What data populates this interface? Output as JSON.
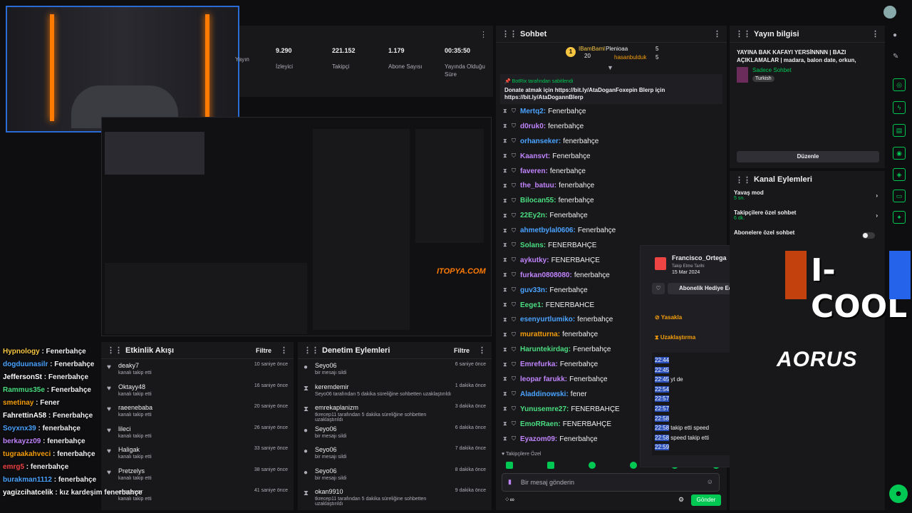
{
  "stats": [
    {
      "value": "",
      "label": "Yayın"
    },
    {
      "value": "9.290",
      "label": "İzleyici"
    },
    {
      "value": "221.152",
      "label": "Takipçi"
    },
    {
      "value": "1.179",
      "label": "Abone Sayısı"
    },
    {
      "value": "00:35:50",
      "label": "Yayında Olduğu Süre"
    }
  ],
  "activity": {
    "title": "Etkinlik Akışı",
    "filter": "Filtre",
    "items": [
      {
        "name": "deaky7",
        "sub": "kanalı takip etti",
        "time": "10 saniye önce"
      },
      {
        "name": "Oktayy48",
        "sub": "kanalı takip etti",
        "time": "16 saniye önce"
      },
      {
        "name": "raeenebaba",
        "sub": "kanalı takip etti",
        "time": "20 saniye önce"
      },
      {
        "name": "lileci",
        "sub": "kanalı takip etti",
        "time": "26 saniye önce"
      },
      {
        "name": "Haligak",
        "sub": "kanalı takip etti",
        "time": "33 saniye önce"
      },
      {
        "name": "Pretzelys",
        "sub": "kanalı takip etti",
        "time": "38 saniye önce"
      },
      {
        "name": "emsever",
        "sub": "kanalı takip etti",
        "time": "41 saniye önce"
      }
    ]
  },
  "moderation": {
    "title": "Denetim Eylemleri",
    "filter": "Filtre",
    "items": [
      {
        "name": "Seyo06",
        "sub": "bir mesajı sildi",
        "time": "6 saniye önce"
      },
      {
        "name": "keremdemir",
        "sub": "Seyo06 tarafından 5 dakika süreliğine sohbetten uzaklaştırıldı",
        "time": "1 dakika önce"
      },
      {
        "name": "emrekaplanizm",
        "sub": "tkrecep11 tarafından 5 dakika süreliğine sohbetten uzaklaştırıldı",
        "time": "3 dakika önce"
      },
      {
        "name": "Seyo06",
        "sub": "bir mesajı sildi",
        "time": "6 dakika önce"
      },
      {
        "name": "Seyo06",
        "sub": "bir mesajı sildi",
        "time": "7 dakika önce"
      },
      {
        "name": "Seyo06",
        "sub": "bir mesajı sildi",
        "time": "8 dakika önce"
      },
      {
        "name": "okan9910",
        "sub": "tkrecep11 tarafından 5 dakika süreliğine sohbetten uzaklaştırıldı",
        "time": "9 dakika önce"
      }
    ]
  },
  "overlay_chat": [
    {
      "user": "Hypnology",
      "text": " : Fenerbahçe",
      "color": "#f5c542"
    },
    {
      "user": "dogduunasilr",
      "text": " : Fenerbahçe",
      "color": "#4aa3ff"
    },
    {
      "user": "JeffersonSt",
      "text": " : Fenerbahçe",
      "color": "#ffffff"
    },
    {
      "user": "Rammus35e",
      "text": " : Fenerbahçe",
      "color": "#4ade80"
    },
    {
      "user": "smetinay",
      "text": " : Fener",
      "color": "#f59e0b"
    },
    {
      "user": "FahrettinA58",
      "text": " : Fenerbahçe",
      "color": "#ffffff"
    },
    {
      "user": "Soyxnx39",
      "text": " : fenerbahçe",
      "color": "#4aa3ff"
    },
    {
      "user": "berkayzz09",
      "text": " : fenerbahçe",
      "color": "#c084fc"
    },
    {
      "user": "tugraakahveci",
      "text": " : fenerbahçe",
      "color": "#f59e0b"
    },
    {
      "user": "emrg5",
      "text": " : fenerbahçe",
      "color": "#ef4444"
    },
    {
      "user": "burakman1112",
      "text": " : fenerbahçe",
      "color": "#4aa3ff"
    },
    {
      "user": "yagizcihatcelik",
      "text": " : kız kardeşim fenerbahçe",
      "color": "#ffffff"
    }
  ],
  "chat": {
    "title": "Sohbet",
    "top": [
      {
        "name": "IBamBaml",
        "count": "20"
      },
      {
        "name": "Plenioaa",
        "count": "5"
      },
      {
        "name": "hasanbulduk",
        "count": "5"
      }
    ],
    "pin_by": "BotRix tarafından sabitlendi",
    "pin_text": "Donate atmak için https://bit.ly/AtaDoganFoxepin Blerp için https://bit.ly/AtaDogannBlerp",
    "messages": [
      {
        "user": "Mertq2",
        "text": "Fenerbahçe",
        "color": "#4aa3ff"
      },
      {
        "user": "d0ruk0",
        "text": "fenerbahçe",
        "color": "#c084fc"
      },
      {
        "user": "orhanseker",
        "text": "fenerbahçe",
        "color": "#4aa3ff"
      },
      {
        "user": "Kaansvt",
        "text": "Fenerbahçe",
        "color": "#c084fc"
      },
      {
        "user": "faveren",
        "text": "fenerbahçe",
        "color": "#c084fc"
      },
      {
        "user": "the_batuu",
        "text": "fenerbahçe",
        "color": "#c084fc"
      },
      {
        "user": "Bilocan55",
        "text": "fenerbahçe",
        "color": "#4ade80"
      },
      {
        "user": "22Ey2n",
        "text": "Fenerbahçe",
        "color": "#4ade80"
      },
      {
        "user": "ahmetbylal0606",
        "text": "Fenerbahçe",
        "color": "#4aa3ff"
      },
      {
        "user": "Solans",
        "text": "FENERBAHÇE",
        "color": "#4ade80"
      },
      {
        "user": "aykutky",
        "text": "FENERBAHÇE",
        "color": "#c084fc"
      },
      {
        "user": "furkan0808080",
        "text": "fenerbahçe",
        "color": "#c084fc"
      },
      {
        "user": "guv33n",
        "text": "Fenerbahçe",
        "color": "#4aa3ff"
      },
      {
        "user": "Eege1",
        "text": "FENERBAHCE",
        "color": "#4ade80"
      },
      {
        "user": "esenyurtlumiko",
        "text": "fenerbahçe",
        "color": "#4aa3ff"
      },
      {
        "user": "muratturna",
        "text": "fenerbahçe",
        "color": "#f59e0b"
      },
      {
        "user": "Haruntekirdag",
        "text": "Fenerbahçe",
        "color": "#4ade80"
      },
      {
        "user": "Emrefurka",
        "text": "Fenerbahçe",
        "color": "#c084fc"
      },
      {
        "user": "leopar farukk",
        "text": "Fenerbahçe",
        "color": "#c084fc"
      },
      {
        "user": "Aladdinowski",
        "text": "fener",
        "color": "#4aa3ff"
      },
      {
        "user": "Yunusemre27",
        "text": "FENERBAHÇE",
        "color": "#4ade80"
      },
      {
        "user": "EmoRRaen",
        "text": "FENERBAHÇE",
        "color": "#4ade80"
      },
      {
        "user": "Eyazom09",
        "text": "Fenerbahçe",
        "color": "#c084fc"
      }
    ],
    "followers_only": "Takipçilere Özel",
    "placeholder": "Bir mesaj gönderin",
    "send": "Gönder"
  },
  "popup": {
    "name": "Francisco_Ortega",
    "follow_label": "Takip Etme Tarihi",
    "follow_date": "15 Mar 2024",
    "gift": "Abonelik Hediye Edin",
    "ban": "Yasakla",
    "timeout": "Uzaklaştırma",
    "log": [
      {
        "t": "22:44",
        "m": ""
      },
      {
        "t": "22:45",
        "m": ""
      },
      {
        "t": "22:45",
        "m": "yt de"
      },
      {
        "t": "22:54",
        "m": ""
      },
      {
        "t": "22:57",
        "m": ""
      },
      {
        "t": "22:57",
        "m": ""
      },
      {
        "t": "22:58",
        "m": ""
      },
      {
        "t": "22:58",
        "m": "takip etti speed"
      },
      {
        "t": "22:58",
        "m": "speed takip etti"
      },
      {
        "t": "22:59",
        "m": ""
      }
    ]
  },
  "info": {
    "title": "Yayın bilgisi",
    "stream_title": "YAYINA BAK KAFAYI YERSİNNNN | BAZI AÇIKLAMALAR | madara, balon date, orkun, soğuk...",
    "category": "Sadece Sohbet",
    "tag": "Turkish",
    "edit": "Düzenle"
  },
  "channel_actions": {
    "title": "Kanal Eylemleri",
    "items": [
      {
        "label": "Yavaş mod",
        "sub": "5 sn."
      },
      {
        "label": "Takipçilere özel sohbet",
        "sub": "6 dk."
      },
      {
        "label": "Abonelere özel sohbet",
        "sub": ""
      }
    ]
  },
  "brand": {
    "icool": "I-COOL",
    "aorus": "AORUS",
    "watermark": "ITOPYA.COM"
  }
}
